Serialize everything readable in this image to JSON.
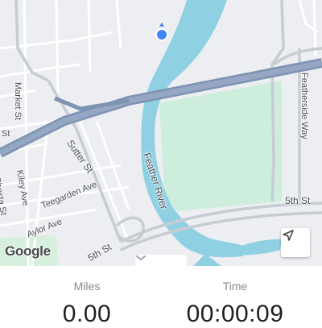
{
  "map": {
    "street_labels": [
      "Market St",
      "Sutter St",
      "Kiley Ave",
      "Teegarden Ave",
      "Aylor Ave",
      "5th St",
      "5th St",
      "Feather River",
      "Featherside Way",
      "Shasta St",
      "St"
    ],
    "attribution": "Google",
    "colors": {
      "water": "#8fd1e3",
      "park": "#cdeedc",
      "highway": "#7e93b3",
      "land": "#eceef1",
      "road": "#ffffff",
      "location_dot": "#4285f4"
    },
    "icons": {
      "my_location": "navigation-arrow-icon",
      "expand": "chevron-down-icon",
      "current_location": "blue-location-dot-icon"
    }
  },
  "stats": {
    "miles_label": "Miles",
    "miles_value": "0.00",
    "time_label": "Time",
    "time_value": "00:00:09"
  }
}
